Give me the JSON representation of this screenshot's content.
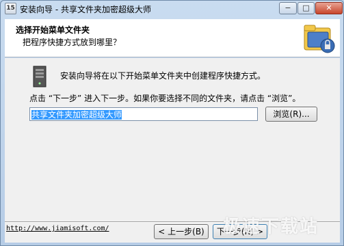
{
  "window": {
    "app_icon_text": "15",
    "title": "安装向导 - 共享文件夹加密超级大师",
    "controls": {
      "minimize": "−",
      "maximize": "□",
      "close": "✕"
    }
  },
  "header": {
    "title": "选择开始菜单文件夹",
    "subtitle": "把程序快捷方式放到哪里？",
    "logo_icon": "folder-lock-icon"
  },
  "content": {
    "info_text": "安装向导将在以下开始菜单文件夹中创建程序快捷方式。",
    "prompt_text": "点击 “下一步” 进入下一步。如果你要选择不同的文件夹，请点击 “浏览”。",
    "folder_value": "共享文件夹加密超级大师",
    "browse_label": "浏览(R)..."
  },
  "footer": {
    "link": "http://www.jiamisoft.com/",
    "back_label": "< 上一步(B)",
    "next_label": "下一步(N) >"
  },
  "watermark": "极速下载站",
  "colors": {
    "selection": "#3399ff",
    "frame": "#b9d1ea",
    "close": "#c8452c"
  }
}
